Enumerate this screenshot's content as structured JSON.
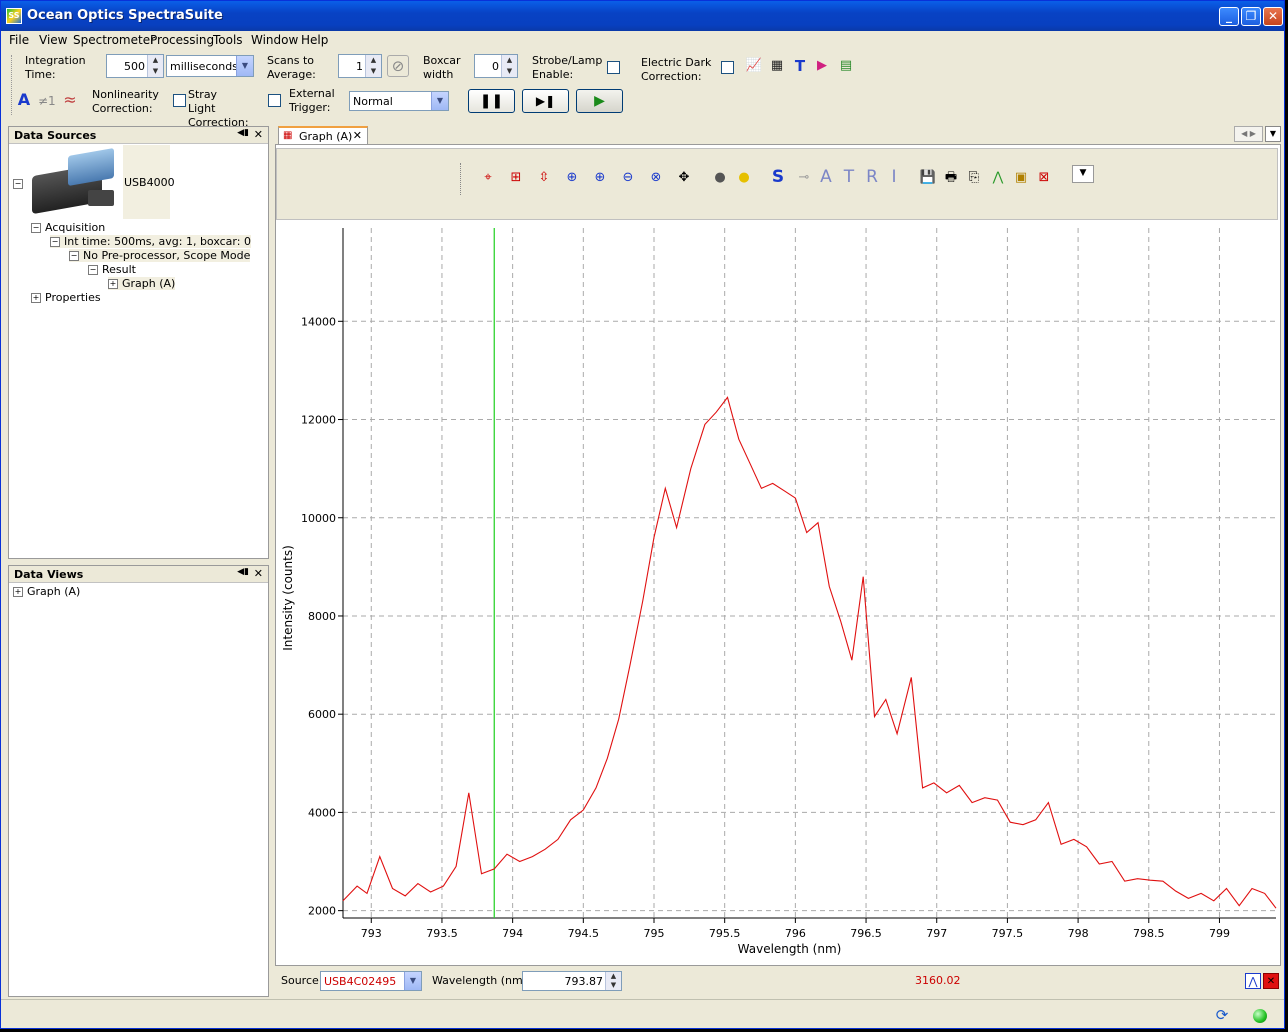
{
  "window": {
    "title": "Ocean Optics SpectraSuite"
  },
  "menu": [
    "File",
    "View",
    "Spectrometer",
    "Processing",
    "Tools",
    "Window",
    "Help"
  ],
  "toolbar": {
    "integration_label": "Integration Time:",
    "integration_value": "500",
    "integration_units": "milliseconds",
    "scans_label": "Scans to Average:",
    "scans_value": "1",
    "boxcar_label": "Boxcar width",
    "boxcar_value": "0",
    "strobe_label": "Strobe/Lamp Enable:",
    "dark_label": "Electric Dark Correction:",
    "nonlin_label": "Nonlinearity Correction:",
    "stray_label": "Stray Light Correction:",
    "trigger_label": "External Trigger:",
    "trigger_value": "Normal",
    "notequal_label": "≠1"
  },
  "data_sources": {
    "title": "Data Sources",
    "device": "USB4000",
    "acquisition": "Acquisition",
    "int_time": "Int time: 500ms, avg: 1, boxcar: 0",
    "preproc": "No Pre-processor, Scope Mode",
    "result": "Result",
    "graph": "Graph (A)",
    "properties": "Properties"
  },
  "data_views": {
    "title": "Data Views",
    "graph": "Graph (A)"
  },
  "graph_tab": {
    "label": "Graph (A)"
  },
  "graph_toolbar": {
    "letters": [
      "S",
      "A",
      "T",
      "R",
      "I"
    ]
  },
  "status": {
    "source_label": "Source:",
    "source_value": "USB4C02495",
    "wavelength_label": "Wavelength (nm):",
    "wavelength_value": "793.87",
    "intensity_value": "3160.02"
  },
  "colors": {
    "trace": "#e01010",
    "cursor": "#2fd32f",
    "title_bar": "#0842c4"
  },
  "chart_data": {
    "type": "line",
    "xlabel": "Wavelength (nm)",
    "ylabel": "Intensity (counts)",
    "xlim": [
      792.8,
      799.4
    ],
    "ylim": [
      1850,
      15900
    ],
    "x_ticks": [
      "793",
      "793.5",
      "794",
      "794.5",
      "795",
      "795.5",
      "796",
      "796.5",
      "797",
      "797.5",
      "798",
      "798.5",
      "799"
    ],
    "y_ticks": [
      "2000",
      "4000",
      "6000",
      "8000",
      "10000",
      "12000",
      "14000"
    ],
    "grid": true,
    "cursor_x": 793.87,
    "series": [
      {
        "x": [
          792.8,
          792.9,
          792.97,
          793.06,
          793.15,
          793.24,
          793.33,
          793.42,
          793.51,
          793.6,
          793.69,
          793.78,
          793.87,
          793.96,
          794.05,
          794.14,
          794.23,
          794.32,
          794.41,
          794.5,
          794.59,
          794.67,
          794.75,
          794.83,
          794.92,
          795.0,
          795.08,
          795.16,
          795.26,
          795.36,
          795.44,
          795.52,
          795.6,
          795.68,
          795.76,
          795.84,
          795.92,
          796.0,
          796.08,
          796.16,
          796.24,
          796.32,
          796.4,
          796.48,
          796.56,
          796.64,
          796.72,
          796.82,
          796.9,
          796.98,
          797.07,
          797.16,
          797.25,
          797.34,
          797.43,
          797.52,
          797.61,
          797.7,
          797.79,
          797.88,
          797.97,
          798.06,
          798.15,
          798.24,
          798.33,
          798.42,
          798.51,
          798.6,
          798.69,
          798.78,
          798.87,
          798.96,
          799.05,
          799.14,
          799.23,
          799.32,
          799.4
        ],
        "y": [
          2200,
          2500,
          2350,
          3100,
          2450,
          2300,
          2550,
          2380,
          2500,
          2900,
          4400,
          2750,
          2850,
          3150,
          3000,
          3100,
          3250,
          3450,
          3850,
          4050,
          4500,
          5100,
          5900,
          7000,
          8300,
          9600,
          10600,
          9800,
          11000,
          11900,
          12150,
          12450,
          11600,
          11100,
          10600,
          10700,
          10550,
          10400,
          9700,
          9900,
          8600,
          7900,
          7100,
          8800,
          5950,
          6300,
          5600,
          6750,
          4500,
          4600,
          4400,
          4550,
          4200,
          4300,
          4250,
          3800,
          3750,
          3850,
          4200,
          3350,
          3450,
          3300,
          2950,
          3000,
          2600,
          2650,
          2620,
          2600,
          2400,
          2250,
          2350,
          2200,
          2450,
          2100,
          2450,
          2350,
          2050
        ]
      }
    ]
  }
}
